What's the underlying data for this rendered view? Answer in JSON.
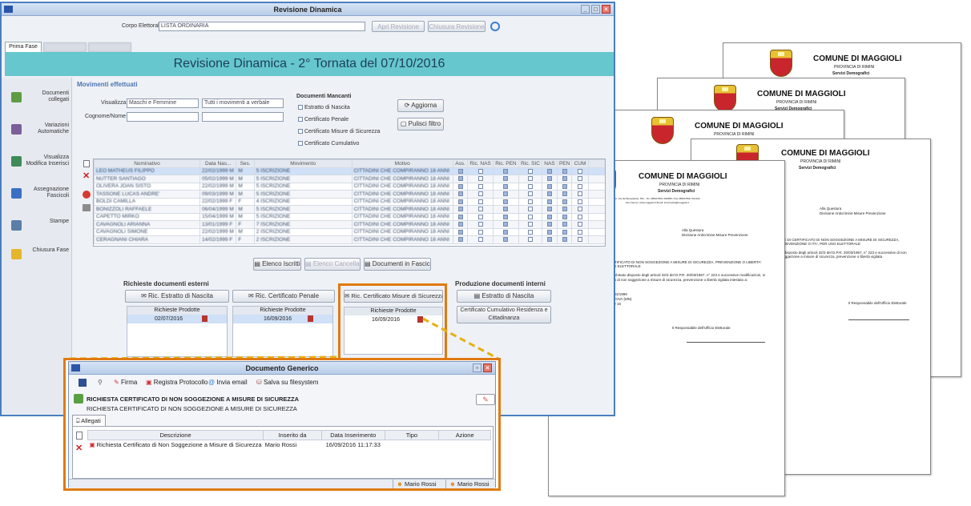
{
  "main_window": {
    "title": "Revisione Dinamica",
    "corpo_label": "Corpo Elettorale",
    "corpo_value": "LISTA ORDINARIA",
    "apri_btn": "Apri Revisione",
    "chiusura_btn": "Chiusura Revisione",
    "tabs": [
      "Prima Fase",
      "",
      ""
    ],
    "banner": "Revisione Dinamica  -  2° Tornata del 07/10/2016"
  },
  "sidebar": [
    {
      "label": "Documenti collegati",
      "icon": "documents-icon"
    },
    {
      "label": "Variazioni Automatiche",
      "icon": "variations-icon"
    },
    {
      "label": "Visualizza Modifica Inserisci",
      "icon": "edit-icon"
    },
    {
      "label": "Assegnazione Fascicoli",
      "icon": "folder-icon"
    },
    {
      "label": "Stampe",
      "icon": "print-icon"
    },
    {
      "label": "Chiusura Fase",
      "icon": "lock-icon"
    }
  ],
  "movimenti": {
    "title": "Movimenti effettuati",
    "visualizza_label": "Visualizza",
    "visualizza_value": "Maschi e Femmine",
    "filtro_value": "Tutti i movimenti a verbale",
    "cognome_label": "Cognome/Nome",
    "doc_mancanti_title": "Documenti Mancanti",
    "doc_mancanti": [
      "Estratto di Nascita",
      "Certificato Penale",
      "Certificato Misure di Sicurezza",
      "Certificato Cumulativo"
    ],
    "aggiorna_btn": "Aggiorna",
    "pulisci_btn": "Pulisci filtro"
  },
  "grid": {
    "headers": [
      "Nominativo",
      "Data Nas...",
      "Ses.",
      "Movimento",
      "Motivo",
      "Ass.",
      "Ric. NAS",
      "Ric. PEN",
      "Ric. SIC",
      "NAS",
      "PEN",
      "CUM",
      ""
    ],
    "rows": [
      [
        "LEO MATHEUS FILIPPO",
        "22/02/1999 M",
        "M",
        "5 ISCRIZIONE",
        "CITTADINI CHE COMPIRANNO 18 ANNI"
      ],
      [
        "NUTTER SANTIAGO",
        "05/02/1999 M",
        "M",
        "5 ISCRIZIONE",
        "CITTADINI CHE COMPIRANNO 18 ANNI"
      ],
      [
        "OLIVERA JOAN SISTO",
        "22/02/1999 M",
        "M",
        "5 ISCRIZIONE",
        "CITTADINI CHE COMPIRANNO 18 ANNI"
      ],
      [
        "TASSONE LUCAS ANDRE'",
        "09/03/1999 M",
        "M",
        "5 ISCRIZIONE",
        "CITTADINI CHE COMPIRANNO 18 ANNI"
      ],
      [
        "BOLDI CAMILLA",
        "22/02/1999 F",
        "F",
        "4 ISCRIZIONE",
        "CITTADINI CHE COMPIRANNO 18 ANNI"
      ],
      [
        "BONIZZOLI RAFFAELE",
        "06/04/1999 M",
        "M",
        "5 ISCRIZIONE",
        "CITTADINI CHE COMPIRANNO 18 ANNI"
      ],
      [
        "CAPETTO MIRKO",
        "15/04/1999 M",
        "M",
        "5 ISCRIZIONE",
        "CITTADINI CHE COMPIRANNO 18 ANNI"
      ],
      [
        "CAVAGNOLI ARIANNA",
        "13/01/1999 F",
        "F",
        "7 ISCRIZIONE",
        "CITTADINI CHE COMPIRANNO 18 ANNI"
      ],
      [
        "CAVAGNOLI SIMONE",
        "22/02/1999 M",
        "M",
        "2 ISCRIZIONE",
        "CITTADINI CHE COMPIRANNO 18 ANNI"
      ],
      [
        "CERAGNANI CHIARA",
        "14/02/1999 F",
        "F",
        "2 ISCRIZIONE",
        "CITTADINI CHE COMPIRANNO 18 ANNI"
      ]
    ],
    "elenco_iscritti": "Elenco Iscritti",
    "elenco_cancellati": "Elenco Cancellati",
    "documenti_fascicoli": "Documenti in Fascicoli"
  },
  "richieste": {
    "title": "Richieste documenti esterni",
    "btn_nascita": "Ric. Estratto di Nascita",
    "btn_penale": "Ric. Certificato Penale",
    "btn_sicurezza": "Ric. Certificato Misure di Sicurezza",
    "col_header": "Richieste Prodotte",
    "date_nascita": "02/07/2016",
    "date_penale": "16/09/2016",
    "date_sicurezza": "16/09/2016"
  },
  "produzione": {
    "title": "Produzione documenti interni",
    "btn_nascita": "Estratto di Nascita",
    "btn_cumulativo": "Certificato Cumulativo Residenza e Cittadinanza"
  },
  "popup": {
    "title": "Documento Generico",
    "toolbar": [
      "Firma",
      "Registra Protocollo",
      "Invia email",
      "Salva su filesystem"
    ],
    "heading": "RICHIESTA CERTIFICATO DI NON SOGGEZIONE A MISURE DI SICUREZZA",
    "subheading": "RICHIESTA CERTIFICATO DI NON SOGGEZIONE A MISURE DI SICUREZZA",
    "tab": "Allegati",
    "columns": [
      "Descrizione",
      "Inserito da",
      "Data Inserimento",
      "Tipo",
      "Azione"
    ],
    "rows": [
      [
        "Richiesta Certificato di Non Soggezione a Misure di Sicurezza",
        "Mario Rossi",
        "16/09/2016 11:17:33",
        "",
        ""
      ]
    ],
    "status": [
      "Mario Rossi",
      "Mario Rossi"
    ]
  },
  "document": {
    "comune": "COMUNE DI MAGGIOLI",
    "provincia": "PROVINCIA DI RIMINI",
    "servizi": "Servizi Demografici",
    "header_small": "Sede: Via del Beneplacito, 561 - Tel. 28090 8541 628380 / Fax 28090 8541 621222",
    "header_small2": "sito internet: www.maggioli.it    Email: informatica@maggioli.it",
    "dest1": "Alla Questura",
    "dest2": "Divisione Anticrimine Misure Prevenzione",
    "oggetto_label": "OGGETTO:",
    "oggetto": "RICHIESTA DI CERTIFICATO DI NON SOGGEZIONE A MISURE DI SICUREZZA, PREVENZIONE O LIBERTA' VIGILATA, PER USO ELETTORALE",
    "body1": "Ai sensi e per gli effetti del combinato disposto degli articoli 32/3 del D.P.R. 20/03/1967, n° 223 e successive modificazioni, si richiede il rilascio del certificato di non soggezione a misure di sicurezza, prevenzione o libertà vigilata intestato a:",
    "nato_label": "nato a",
    "nato_date": "il 29/03/1999",
    "atto": "Atto nr.8/1999 P. 1 S. A. MANTOVA (MN)",
    "residente": "Residente in VIA SAN ROCCO 16",
    "place_date": "MAGGIOLI, 16/09/2016",
    "signature": "Il Responsabile dell'Ufficio Elettorale",
    "rear_oggetto": "NE DI CERTIFICATO DI NON SOGGEZIONE A MISURE DI SICUREZZA, PREVENZIONE O ITA', PER USO ELETTORALE",
    "rear_body": "o disposto degli articoli 32/3 del D.P.R. 20/03/1967, n° 223 e successive di non soggezione a misure di sicurezza, prevenzione o libertà vigilata"
  }
}
